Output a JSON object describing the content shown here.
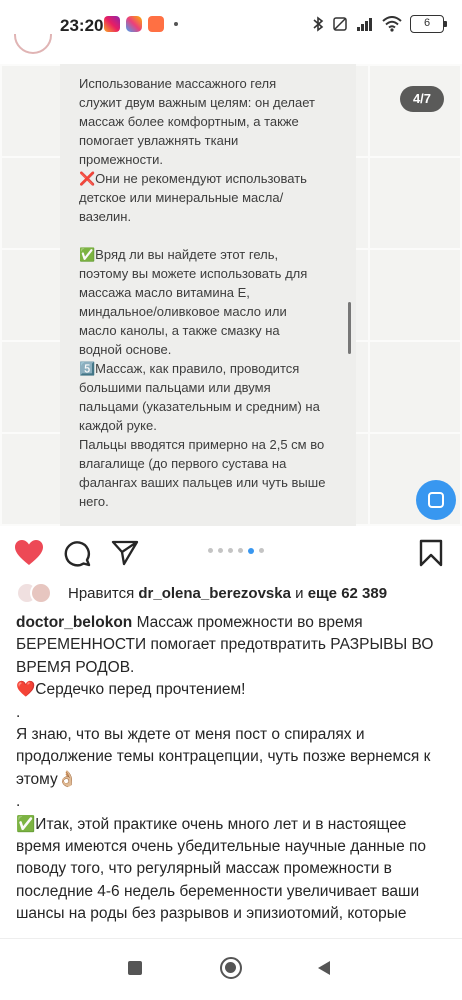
{
  "status_bar": {
    "time": "23:20",
    "battery": "6",
    "icons": [
      "instagram-icon",
      "instagram-alt-icon",
      "orange-app-icon",
      "bluetooth-icon",
      "mute-icon",
      "signal-icon",
      "wifi-icon"
    ]
  },
  "post": {
    "counter": "4/7",
    "slide_lines": [
      "Использование массажного геля",
      "служит двум важным целям: он делает",
      "массаж более комфортным, а также",
      "помогает увлажнять ткани",
      "промежности.",
      "❌Они не рекомендуют использовать",
      "детское или минеральные масла/",
      "вазелин.",
      "",
      "✅Вряд ли вы найдете этот гель,",
      "поэтому вы можете использовать для",
      "массажа масло витамина Е,",
      "миндальное/оливковое масло или",
      "масло канолы, а также смазку на",
      "водной основе.",
      "5️⃣Массаж, как правило, проводится",
      "большими пальцами или двумя",
      "пальцами (указательным и средним) на",
      "каждой руке.",
      "Пальцы вводятся примерно на 2,5 см во",
      "влагалище (до первого сустава на",
      "фалангах ваших пальцев или чуть выше",
      "него."
    ],
    "carousel": {
      "total": 7,
      "current": 4
    }
  },
  "actions": {
    "icons": [
      "heart-icon",
      "comment-icon",
      "share-icon",
      "bookmark-icon"
    ],
    "liked_color": "#ed4956"
  },
  "likes": {
    "prefix": "Нравится ",
    "user": "dr_olena_berezovska",
    "middle": " и ",
    "others": "еще 62 389"
  },
  "caption": {
    "author": "doctor_belokon",
    "text_1": " Массаж промежности во время БЕРЕМЕННОСТИ помогает предотвратить РАЗРЫВЫ ВО ВРЕМЯ РОДОВ.",
    "line_2": "❤️Сердечко перед прочтением!",
    "dot_1": ".",
    "line_3": "Я знаю, что вы ждете от меня пост о спиралях и продолжение темы контрацепции, чуть позже вернемся к этому👌🏼",
    "dot_2": ".",
    "line_4": "✅Итак, этой практике очень много лет и в настоящее время имеются очень убедительные научные данные по поводу того, что регулярный массаж промежности в последние 4-6 недель беременности увеличивает ваши шансы на роды без разрывов и эпизиотомий, которые могут в последствии приводить к проблемам"
  },
  "nav_bar": {
    "icons": [
      "recents-icon",
      "home-icon",
      "back-icon"
    ]
  },
  "colors": {
    "accent": "#3897f0",
    "heart": "#ed4956",
    "text": "#262626"
  }
}
